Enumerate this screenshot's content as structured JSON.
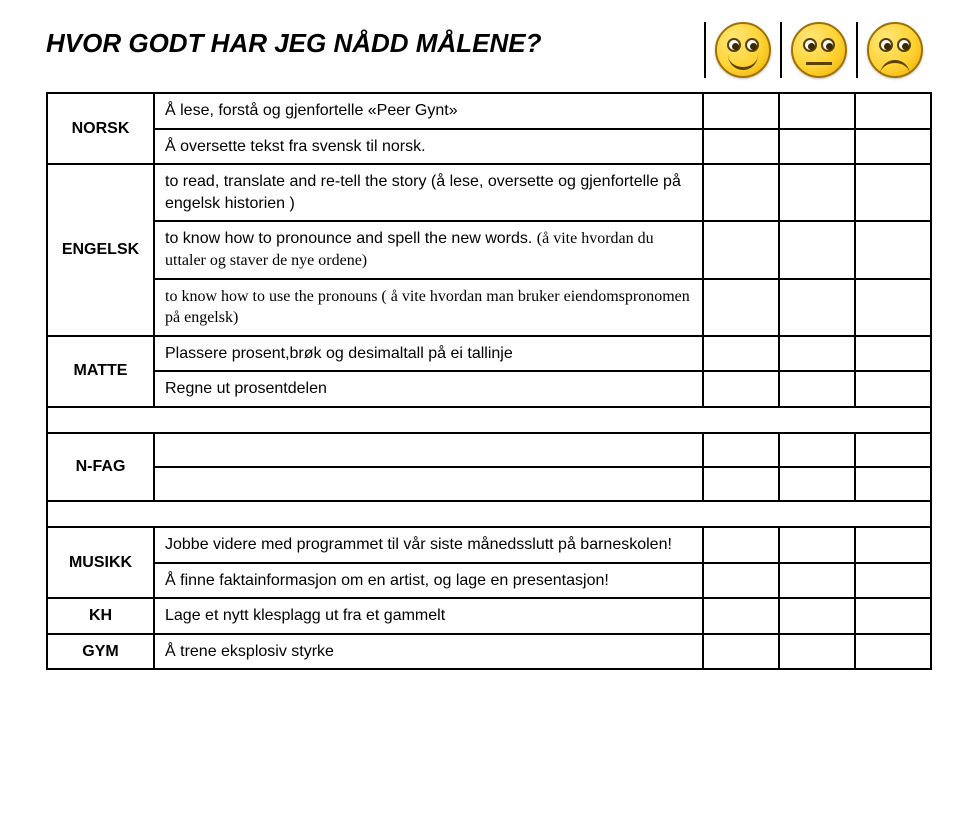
{
  "title": "HVOR GODT HAR JEG NÅDD MÅLENE?",
  "faces": {
    "happy": "face-happy",
    "neutral": "face-neutral",
    "sad": "face-sad"
  },
  "subjects": {
    "norsk": "NORSK",
    "engelsk": "ENGELSK",
    "matte": "MATTE",
    "nfag": "N-FAG",
    "musikk": "MUSIKK",
    "kh": "KH",
    "gym": "GYM"
  },
  "goals": {
    "norsk1": "Å lese, forstå og gjenfortelle «Peer Gynt»",
    "norsk2": "Å oversette tekst fra svensk til norsk.",
    "engelsk1a": "to read, translate and re-tell the story  (å lese, oversette og gjenfortelle på engelsk historien )",
    "engelsk2a": "to know how to pronounce and spell the new words. ",
    "engelsk2b": "(å vite hvordan du uttaler og staver de nye ordene)",
    "engelsk3a": "to know how to use the pronouns ( å vite hvordan man bruker eiendomspronomen på engelsk)",
    "matte1": "Plassere prosent,brøk og desimaltall på ei tallinje",
    "matte2": "Regne ut prosentdelen",
    "musikk1": "Jobbe videre med programmet til vår siste månedsslutt på barneskolen!",
    "musikk2": "Å finne faktainformasjon om en artist, og lage en presentasjon!",
    "kh1": "Lage et nytt klesplagg ut fra et gammelt",
    "gym1": "Å trene eksplosiv styrke"
  }
}
